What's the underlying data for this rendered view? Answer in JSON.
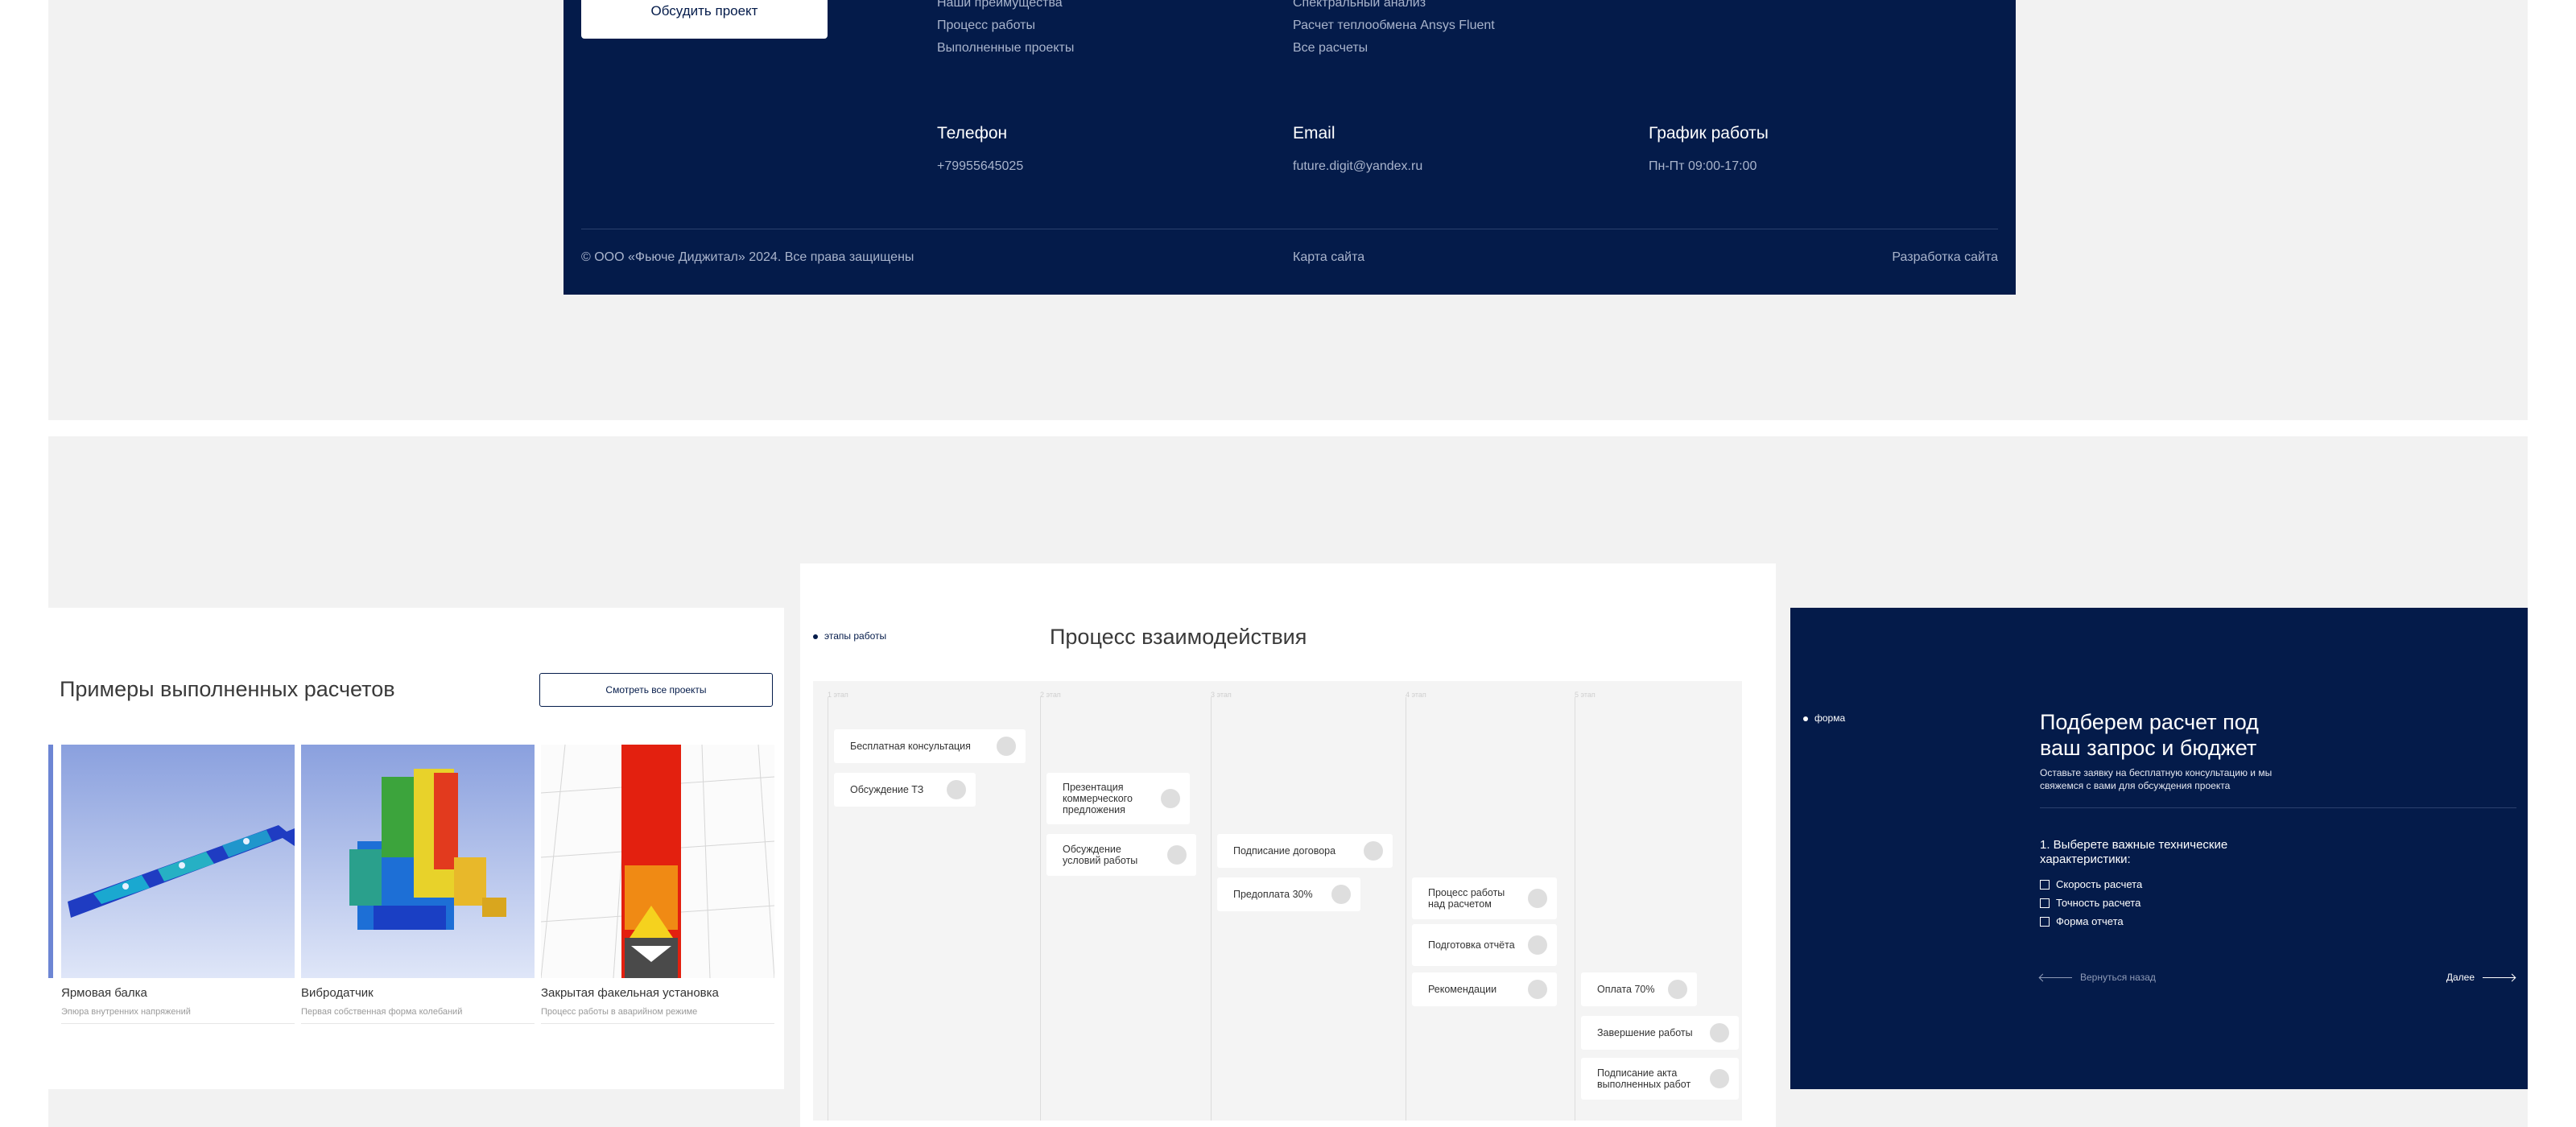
{
  "footer": {
    "cta_label": "Обсудить проект",
    "nav_links": [
      "Наши преимущества",
      "Процесс работы",
      "Выполненные проекты"
    ],
    "service_links": [
      "Спектральный анализ",
      "Расчет теплообмена Ansys Fluent",
      "Все расчеты"
    ],
    "phone": {
      "heading": "Телефон",
      "value": "+79955645025"
    },
    "email": {
      "heading": "Email",
      "value": "future.digit@yandex.ru"
    },
    "schedule": {
      "heading": "График работы",
      "value": "Пн-Пт 09:00-17:00"
    },
    "copyright": "© ООО «Фьюче Диджитал» 2024. Все права защищены",
    "sitemap": "Карта сайта",
    "dev": "Разработка сайта"
  },
  "projects": {
    "title": "Примеры выполненных расчетов",
    "button": "Смотреть все проекты",
    "items": [
      {
        "name": "Ярмовая балка",
        "desc": "Эпюра внутренних напряжений"
      },
      {
        "name": "Вибродатчик",
        "desc": "Первая собственная форма колебаний"
      },
      {
        "name": "Закрытая факельная установка",
        "desc": "Процесс работы в аварийном режиме"
      }
    ]
  },
  "process": {
    "tag": "этапы работы",
    "title": "Процесс взаимодействия",
    "columns": [
      "1 этап",
      "2 этап",
      "3 этап",
      "4 этап",
      "5 этап"
    ],
    "steps": [
      "Бесплатная консультация",
      "Обсуждение ТЗ",
      "Презентация коммерческого предложения",
      "Обсуждение условий работы",
      "Подписание договора",
      "Предоплата 30%",
      "Процесс работы над расчетом",
      "Подготовка отчёта",
      "Рекомендации",
      "Оплата 70%",
      "Завершение работы",
      "Подписание акта выполненных работ"
    ]
  },
  "form": {
    "tag": "форма",
    "title": "Подберем расчет под ваш запрос и бюджет",
    "subtitle": "Оставьте заявку на бесплатную консультацию и мы свяжемся с вами для обсуждения проекта",
    "question": "1. Выберете важные технические характеристики:",
    "options": [
      "Скорость расчета",
      "Точность расчета",
      "Форма отчета"
    ],
    "back": "Вернуться назад",
    "next": "Далее"
  },
  "colors": {
    "navy": "#041b4a",
    "panel": "#f2f2f2"
  }
}
